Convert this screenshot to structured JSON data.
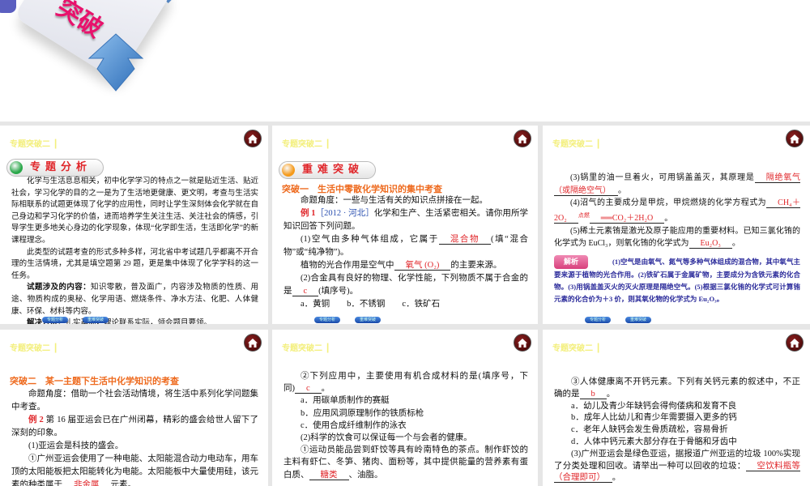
{
  "banner": {
    "title_fragment": "突破"
  },
  "colors": {
    "header": "#f3ef7c",
    "answer": "#e0262a",
    "heading": "#ee6a1e",
    "explanation": "#2a2a9a"
  },
  "nav": {
    "prev_label": "专题分析",
    "next_label": "重难突破"
  },
  "slides": [
    {
      "header": "专题突破二 ┃",
      "badge": {
        "label": "专题分析",
        "color": "#2aa84a"
      },
      "paras": [
        {
          "segs": [
            {
              "text": "化学与生活息息相关，初中化学学习的特点之一就是贴近生活、贴近社会，学习化学的目的之一是为了生活地更健康、更文明，考查与生活实际相联系的试题更体现了化学的应用性，同时让学生深刻体会化学就在自己身边和学习化学的价值，进而培养学生关注生活、关注社会的情感，引导学生更多地关心身边的化学现象，体现“化学即生活，生活即化学”的新课程理念。",
              "style": "plain"
            }
          ]
        },
        {
          "segs": [
            {
              "text": "此类型的试题考查的形式多种多样，河北省中考试题几乎都离不开合理的生活情境，尤其是填空题第 29 题，更是集中体现了化学学科的这一任务。",
              "style": "plain"
            }
          ]
        },
        {
          "segs": [
            {
              "text": "试题涉及的内容：",
              "style": "bold"
            },
            {
              "text": "知识零散，普及面广，内容涉及物质的性质、用途、物质构成的奥秘、化学用语、燃烧条件、净水方法、化肥、人体健康、环保、材料等内容。",
              "style": "plain"
            }
          ]
        },
        {
          "segs": [
            {
              "text": "解决方法：",
              "style": "bold"
            },
            {
              "text": "扎实基础，理论联系实际，领会题目要领。",
              "style": "plain"
            }
          ]
        }
      ]
    },
    {
      "header": "专题突破二 ┃",
      "badge": {
        "label": "重难突破",
        "color": "#f59a1a"
      },
      "heading": "突破一　生活中零散化学知识的集中考查",
      "paras": [
        {
          "segs": [
            {
              "text": "命题角度：一些与生活有关的知识点拼接在一起。",
              "style": "plain"
            }
          ]
        },
        {
          "segs": [
            {
              "text": "例 1",
              "style": "red"
            },
            {
              "text": "［2012 · 河北］",
              "style": "blue"
            },
            {
              "text": "化学和生产、生活紧密相关。请你用所学知识回答下列问题。",
              "style": "plain"
            }
          ]
        },
        {
          "segs": [
            {
              "text": "(1)空气由多种气体组成，它属于",
              "style": "plain"
            },
            {
              "text": "混合物",
              "style": "answer"
            },
            {
              "text": "(填“混合物”或“纯净物”)。",
              "style": "plain"
            }
          ]
        },
        {
          "segs": [
            {
              "text": "植物的光合作用是空气中",
              "style": "plain"
            },
            {
              "text": "氧气 (O₂)",
              "style": "answer"
            },
            {
              "text": "的主要来源。",
              "style": "plain"
            }
          ]
        },
        {
          "segs": [
            {
              "text": "(2)合金具有良好的物理、化学性能，下列物质不属于合金的是",
              "style": "plain"
            },
            {
              "text": "c",
              "style": "answer"
            },
            {
              "text": "(填序号)。",
              "style": "plain"
            }
          ]
        },
        {
          "segs": [
            {
              "text": "a．黄铜　　b．不锈钢　　c．铁矿石",
              "style": "plain"
            }
          ]
        }
      ]
    },
    {
      "header": "专题突破二 ┃",
      "paras": [
        {
          "segs": [
            {
              "text": "(3)锅里的油一旦着火，可用锅盖盖灭，其原理是",
              "style": "plain"
            },
            {
              "text": "隔绝氧气（或隔绝空气）",
              "style": "answer"
            },
            {
              "text": "。",
              "style": "plain"
            }
          ]
        },
        {
          "segs": [
            {
              "text": "(4)沼气的主要成分是甲烷，甲烷燃烧的化学方程式为",
              "style": "plain"
            },
            {
              "text": "CH₄＋2O₂",
              "style": "answer"
            },
            {
              "text": "点燃",
              "style": "sup"
            },
            {
              "text": "══CO₂＋2H₂O",
              "style": "answer"
            },
            {
              "text": "。",
              "style": "plain"
            }
          ]
        },
        {
          "segs": [
            {
              "text": "(5)稀土元素铕是激光及原子能应用的重要材料。已知三氯化铕的化学式为 EuCl₃，则氧化铕的化学式为",
              "style": "plain"
            },
            {
              "text": "Eu₂O₃",
              "style": "answer"
            },
            {
              "text": "。",
              "style": "plain"
            }
          ]
        }
      ],
      "explanation": {
        "badge": "解析",
        "text": "(1)空气是由氧气、氮气等多种气体组成的混合物，其中氧气主要来源于植物的光合作用。(2)铁矿石属于金属矿物，主要成分为含铁元素的化合物。(3)用锅盖盖灭火的灭火原理是隔绝空气。(5)根据三氯化铕的化学式可计算铕元素的化合价为＋3 价，则其氧化物的化学式为 Eu₂O₃。"
      }
    },
    {
      "header": "专题突破二 ┃",
      "heading": "突破二　某一主题下生活中化学知识的考查",
      "paras": [
        {
          "segs": [
            {
              "text": "命题角度：借助一个社会活动情境，将生活中系列化学问题集中考查。",
              "style": "plain"
            }
          ]
        },
        {
          "segs": [
            {
              "text": "例 2",
              "style": "red"
            },
            {
              "text": " 第 16 届亚运会已在广州闭幕，精彩的盛会给世人留下了深刻的印象。",
              "style": "plain"
            }
          ]
        },
        {
          "segs": [
            {
              "text": "(1)亚运会是科技的盛会。",
              "style": "plain"
            }
          ]
        },
        {
          "segs": [
            {
              "text": "①广州亚运会使用了一种电能、太阳能混合动力电动车，用车顶的太阳能板把太阳能转化为电能。太阳能板中大量使用硅，该元素的种类属于",
              "style": "plain"
            },
            {
              "text": "非金属",
              "style": "answer"
            },
            {
              "text": "元素。",
              "style": "plain"
            }
          ]
        }
      ]
    },
    {
      "header": "专题突破二 ┃",
      "paras": [
        {
          "segs": [
            {
              "text": "②下列应用中，主要使用有机合成材料的是(填序号，下同)",
              "style": "plain"
            },
            {
              "text": "c",
              "style": "answer"
            },
            {
              "text": "。",
              "style": "plain"
            }
          ]
        },
        {
          "segs": [
            {
              "text": "a．用碳单质制作的赛艇",
              "style": "plain"
            }
          ]
        },
        {
          "segs": [
            {
              "text": "b．应用风洞原理制作的铁质标枪",
              "style": "plain"
            }
          ]
        },
        {
          "segs": [
            {
              "text": "c．使用合成纤维制作的泳衣",
              "style": "plain"
            }
          ]
        },
        {
          "segs": [
            {
              "text": "(2)科学的饮食可以保证每一个与会者的健康。",
              "style": "plain"
            }
          ]
        },
        {
          "segs": [
            {
              "text": "①运动员能品尝到虾饺等具有岭南特色的茶点。制作虾饺的主料有虾仁、冬笋、猪肉、面粉等，其中提供能量的营养素有蛋白质、",
              "style": "plain"
            },
            {
              "text": "糖类",
              "style": "answer"
            },
            {
              "text": "、油脂。",
              "style": "plain"
            }
          ]
        }
      ]
    },
    {
      "header": "专题突破二 ┃",
      "paras": [
        {
          "segs": [
            {
              "text": "③人体健康离不开钙元素。下列有关钙元素的叙述中，不正确的是",
              "style": "plain"
            },
            {
              "text": "b",
              "style": "answer"
            },
            {
              "text": "。",
              "style": "plain"
            }
          ]
        },
        {
          "segs": [
            {
              "text": "a．幼儿及青少年缺钙会得佝偻病和发育不良",
              "style": "plain"
            }
          ]
        },
        {
          "segs": [
            {
              "text": "b．成年人比幼儿和青少年需要摄入更多的钙",
              "style": "plain"
            }
          ]
        },
        {
          "segs": [
            {
              "text": "c．老年人缺钙会发生骨质疏松，容易骨折",
              "style": "plain"
            }
          ]
        },
        {
          "segs": [
            {
              "text": "d．人体中钙元素大部分存在于骨骼和牙齿中",
              "style": "plain"
            }
          ]
        },
        {
          "segs": [
            {
              "text": "(3)广州亚运会是绿色亚运，据报道广州亚运的垃圾 100%实现了分类处理和回收。请举出一种可以回收的垃圾：",
              "style": "plain"
            },
            {
              "text": "空饮料瓶等（合理即可）",
              "style": "answer"
            },
            {
              "text": "。",
              "style": "plain"
            }
          ]
        }
      ]
    }
  ]
}
